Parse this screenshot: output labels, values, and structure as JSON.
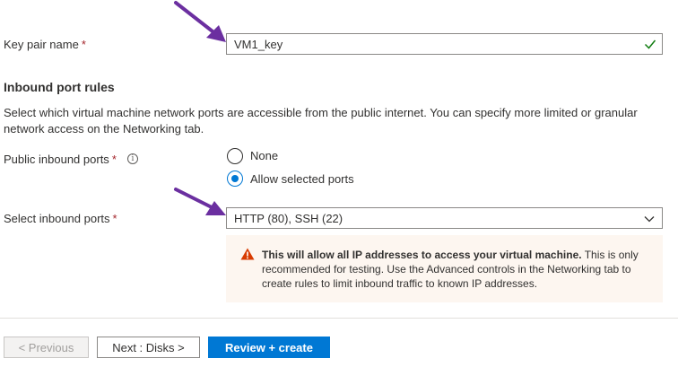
{
  "key_pair": {
    "label": "Key pair name",
    "required_mark": "*",
    "value": "VM1_key",
    "status_icon": "check-icon"
  },
  "inbound": {
    "title": "Inbound port rules",
    "description": "Select which virtual machine network ports are accessible from the public internet. You can specify more limited or granular network access on the Networking tab.",
    "public_label": "Public inbound ports",
    "required_mark": "*",
    "info_icon": "info-icon",
    "options": [
      {
        "label": "None",
        "selected": false
      },
      {
        "label": "Allow selected ports",
        "selected": true
      }
    ],
    "select_label": "Select inbound ports",
    "select_value": "HTTP (80), SSH (22)"
  },
  "warning": {
    "bold": "This will allow all IP addresses to access your virtual machine.",
    "text": "This is only recommended for testing.  Use the Advanced controls in the Networking tab to create rules to limit inbound traffic to known IP addresses."
  },
  "footer": {
    "previous": "< Previous",
    "next": "Next : Disks >",
    "review": "Review + create"
  },
  "colors": {
    "accent": "#0078d4",
    "required": "#a4262c",
    "success": "#107c10",
    "warning_icon": "#d83b01",
    "annotation_arrow": "#6b2fa0"
  }
}
